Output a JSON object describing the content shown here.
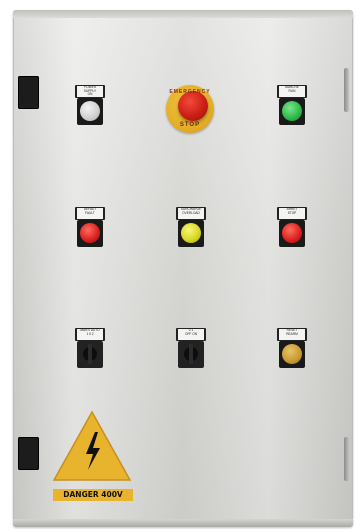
{
  "cabinet": {
    "colors": {
      "panel": "#d9d9d6",
      "hinge": "#1c1c1c",
      "accent_yellow": "#e8b42e"
    }
  },
  "top_row": {
    "left_indicator": {
      "label": "POWER\nSUPPLY\nON",
      "color": "#d4d4d4",
      "icon": "white-indicator-light"
    },
    "emergency_stop": {
      "top_text": "EMERGENCY",
      "bottom_text": "STOP",
      "color": "#cc1f14",
      "icon": "emergency-stop-button"
    },
    "right_button": {
      "label": "MARCHE\nRUN",
      "color": "#2bb845",
      "icon": "green-push-button"
    }
  },
  "middle_row": {
    "left": {
      "label": "DEFAUT\nFAULT",
      "color": "#d91e1e",
      "icon": "red-indicator-light"
    },
    "center": {
      "label": "SURCHARGE\nOVERLOAD",
      "color": "#d6d61f",
      "icon": "yellow-indicator-light"
    },
    "right": {
      "label": "ARRET\nSTOP",
      "color": "#d91e1e",
      "icon": "red-push-button"
    }
  },
  "bottom_row": {
    "left": {
      "label": "MAN 0 AUTO\n1 0 2",
      "icon": "three-position-selector"
    },
    "center": {
      "label": "0 1\nOFF ON",
      "icon": "two-position-selector"
    },
    "right": {
      "label": "RESET\nREARM",
      "color": "#c99a2e",
      "icon": "amber-push-button"
    }
  },
  "warning": {
    "icon": "high-voltage-warning-icon",
    "label": "DANGER 400V"
  }
}
